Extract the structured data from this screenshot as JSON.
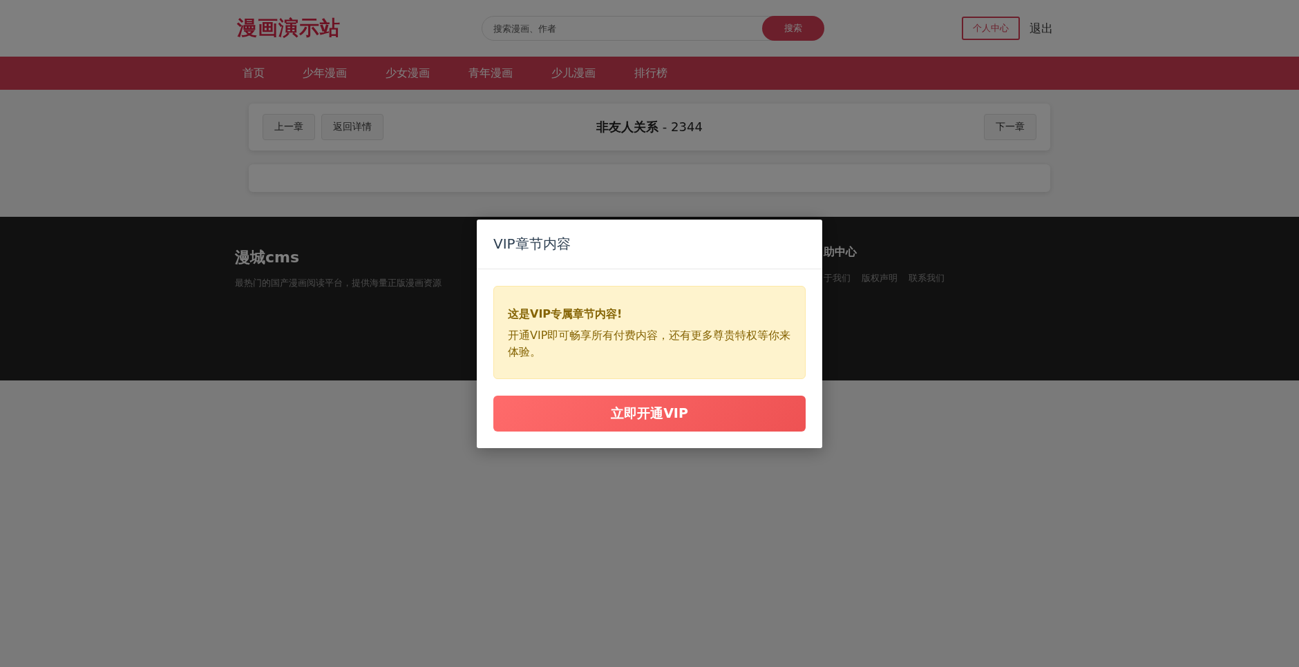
{
  "header": {
    "logo": "漫画演示站",
    "search": {
      "placeholder": "搜索漫画、作者",
      "button": "搜索"
    },
    "user_center": "个人中心",
    "logout": "退出"
  },
  "nav": [
    {
      "label": "首页"
    },
    {
      "label": "少年漫画"
    },
    {
      "label": "少女漫画"
    },
    {
      "label": "青年漫画"
    },
    {
      "label": "少儿漫画"
    },
    {
      "label": "排行榜"
    }
  ],
  "chapter_bar": {
    "prev": "上一章",
    "back": "返回详情",
    "title": "**非友人关系** - 2344",
    "next": "下一章"
  },
  "footer": {
    "brand": "漫城cms",
    "description": "最热门的国产漫画阅读平台，提供海量正版漫画资源",
    "help_title": "助中心",
    "links": [
      "于我们",
      "版权声明",
      "联系我们"
    ]
  },
  "modal": {
    "title": "VIP章节内容",
    "alert_title": "这是VIP专属章节内容!",
    "alert_text": "开通VIP即可畅享所有付费内容，还有更多尊贵特权等你来体验。",
    "button": "立即开通VIP"
  }
}
